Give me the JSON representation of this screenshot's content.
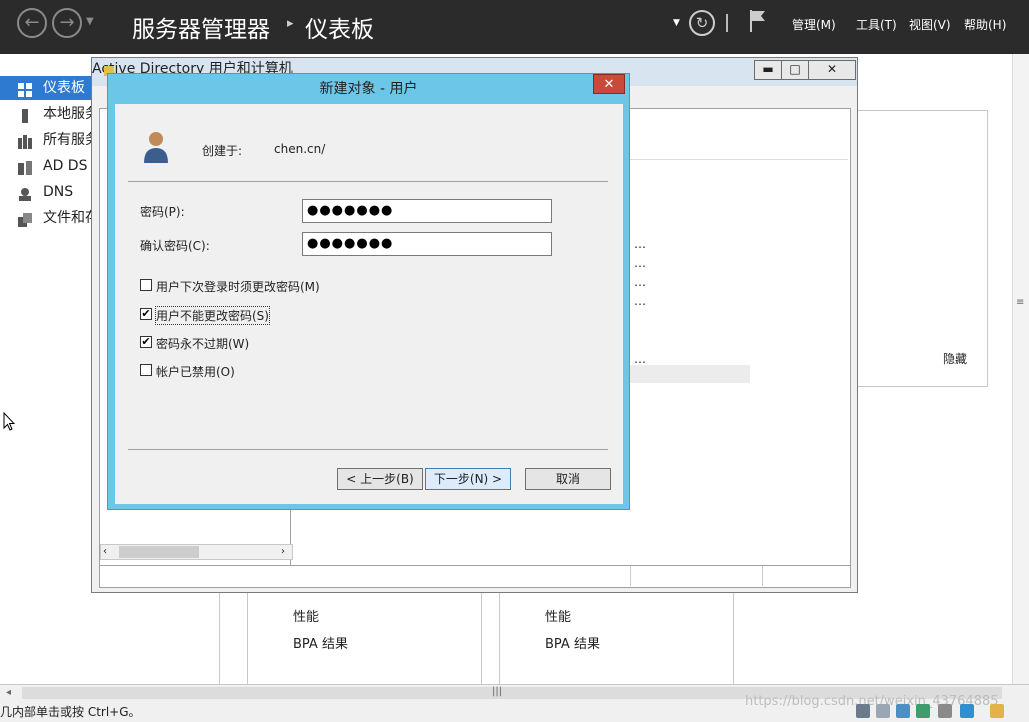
{
  "server_manager": {
    "title": "服务器管理器",
    "breadcrumb": "仪表板",
    "menu": {
      "manage": "管理(M)",
      "tools": "工具(T)",
      "view": "视图(V)",
      "help": "帮助(H)"
    }
  },
  "sidebar": {
    "items": [
      {
        "label": "仪表板",
        "icon": "dashboard-icon"
      },
      {
        "label": "本地服务",
        "icon": "server-icon"
      },
      {
        "label": "所有服务",
        "icon": "servers-icon"
      },
      {
        "label": "AD DS",
        "icon": "ad-icon"
      },
      {
        "label": "DNS",
        "icon": "dns-icon"
      },
      {
        "label": "文件和存",
        "icon": "files-icon"
      }
    ]
  },
  "background": {
    "hide_label": "隐藏",
    "tiles": [
      {
        "perf": "性能",
        "bpa": "BPA 结果"
      },
      {
        "perf": "性能",
        "bpa": "BPA 结果"
      }
    ]
  },
  "ad_window": {
    "title": "Active Directory 用户和计算机",
    "buttons": {
      "minimize": "▬",
      "maximize": "□",
      "close": "✕"
    }
  },
  "dialog": {
    "title": "新建对象 - 用户",
    "created_in_label": "创建于:",
    "created_in_value": "chen.cn/",
    "password_label": "密码(P):",
    "password_value": "●●●●●●●",
    "confirm_label": "确认密码(C):",
    "confirm_value": "●●●●●●●",
    "options": [
      {
        "label": "用户下次登录时须更改密码(M)",
        "checked": false
      },
      {
        "label": "用户不能更改密码(S)",
        "checked": true
      },
      {
        "label": "密码永不过期(W)",
        "checked": true
      },
      {
        "label": "帐户已禁用(O)",
        "checked": false
      }
    ],
    "buttons": {
      "back": "< 上一步(B)",
      "next": "下一步(N) >",
      "cancel": "取消"
    }
  },
  "status_bar": "几内部单击或按 Ctrl+G。",
  "watermark": "https://blog.csdn.net/weixin_43764885"
}
